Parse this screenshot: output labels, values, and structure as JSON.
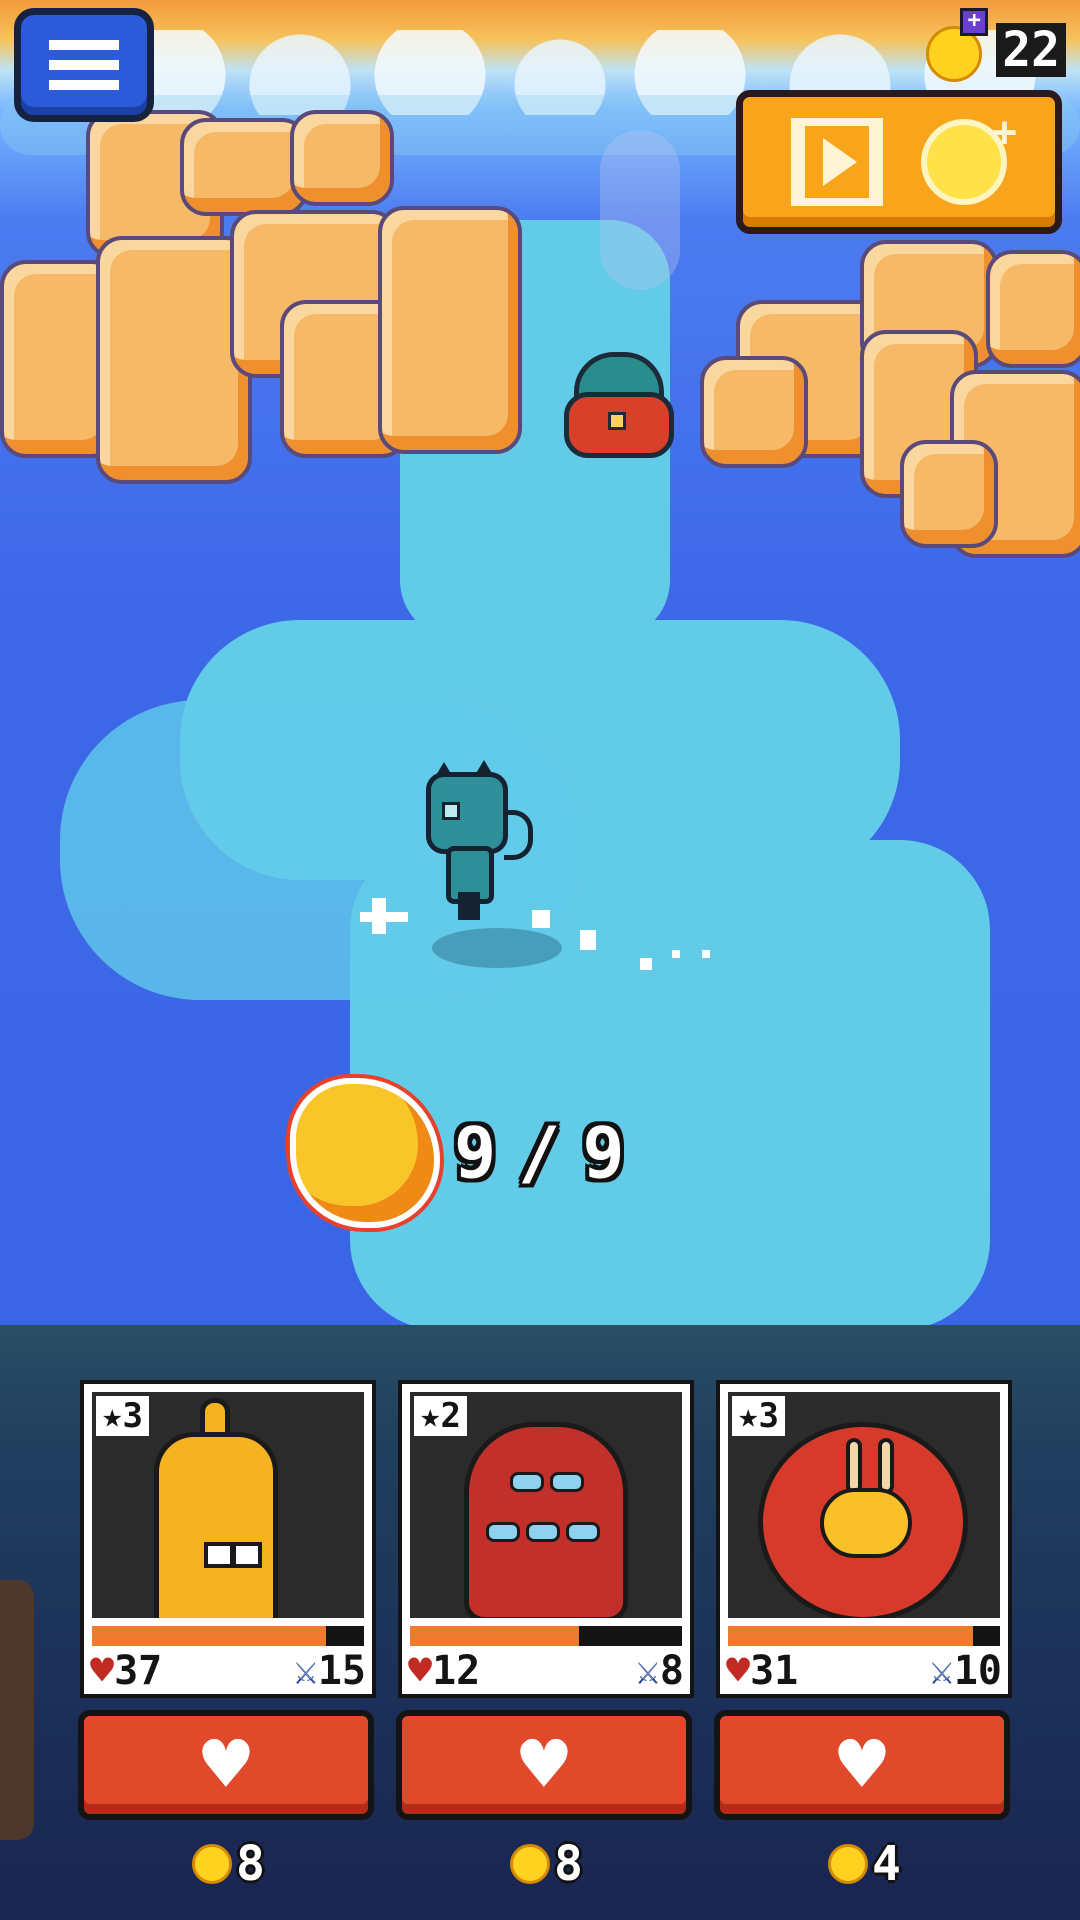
{
  "hud": {
    "menu_icon": "hamburger-menu-icon",
    "currency_count": "22",
    "currency_icon": "coin-plus-icon",
    "video_reward_icons": [
      "film-play-icon",
      "coin-plus-icon"
    ]
  },
  "scene": {
    "fire_counter": {
      "current": "9",
      "separator": "/",
      "max": "9",
      "icon": "fire-icon"
    }
  },
  "party": [
    {
      "rank": "★3",
      "hp": "37",
      "attack": "15",
      "hp_fraction": 0.86,
      "heal_cost": "8",
      "creature": "yellow-banana-creature"
    },
    {
      "rank": "★2",
      "hp": "12",
      "attack": "8",
      "hp_fraction": 0.62,
      "heal_cost": "8",
      "creature": "red-many-eyed-creature"
    },
    {
      "rank": "★3",
      "hp": "31",
      "attack": "10",
      "hp_fraction": 0.9,
      "heal_cost": "4",
      "creature": "red-flower-creature"
    }
  ],
  "icons": {
    "heart": "♥",
    "sword": "⚔",
    "heal": "♥"
  },
  "colors": {
    "water": "#3d69e9",
    "shallow": "#62cbe8",
    "rock": "#f6b968",
    "heal_button": "#e04a2a",
    "video_button": "#f9a51c",
    "hp_fill": "#ef7b2f"
  }
}
